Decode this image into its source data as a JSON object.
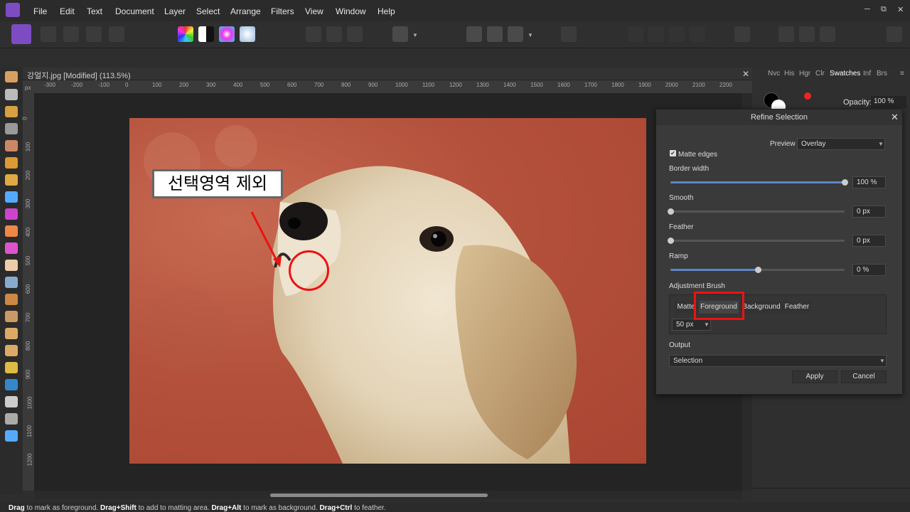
{
  "menu": [
    "File",
    "Edit",
    "Text",
    "Document",
    "Layer",
    "Select",
    "Arrange",
    "Filters",
    "View",
    "Window",
    "Help"
  ],
  "window_controls": [
    "─",
    "⧉",
    "✕"
  ],
  "document": {
    "title": "강얼지.jpg [Modified] (113.5%)",
    "ruler_unit": "px"
  },
  "ruler_h": [
    "-300",
    "-200",
    "-100",
    "0",
    "100",
    "200",
    "300",
    "400",
    "500",
    "600",
    "700",
    "800",
    "900",
    "1000",
    "1100",
    "1200",
    "1300",
    "1400",
    "1500",
    "1600",
    "1700",
    "1800",
    "1900",
    "2000",
    "2100",
    "2200"
  ],
  "ruler_v": [
    "0",
    "100",
    "200",
    "300",
    "400",
    "500",
    "600",
    "700",
    "800",
    "900",
    "1000",
    "1100",
    "1200"
  ],
  "annotation": {
    "label": "선택영역 제외"
  },
  "right_panel": {
    "tabs": [
      "Nvc",
      "His",
      "Hgr",
      "Clr",
      "Swatches",
      "Inf",
      "Brs"
    ],
    "active_tab": "Swatches",
    "opacity_label": "Opacity:",
    "opacity_value": "100 %"
  },
  "refine_dialog": {
    "title": "Refine Selection",
    "preview_label": "Preview",
    "preview_value": "Overlay",
    "matte_edges_label": "Matte edges",
    "matte_edges_checked": true,
    "border_width_label": "Border width",
    "border_width_value": "100 %",
    "border_width_level": 1.0,
    "smooth_label": "Smooth",
    "smooth_value": "0 px",
    "smooth_level": 0.0,
    "feather_label": "Feather",
    "feather_value": "0 px",
    "feather_level": 0.0,
    "ramp_label": "Ramp",
    "ramp_value": "0 %",
    "ramp_level": 0.5,
    "adjustment_brush_label": "Adjustment Brush",
    "brush_modes": [
      "Matte",
      "Foreground",
      "Background",
      "Feather"
    ],
    "brush_mode_selected": "Foreground",
    "brush_size": "50 px",
    "output_label": "Output",
    "output_value": "Selection",
    "apply_label": "Apply",
    "cancel_label": "Cancel"
  },
  "status": {
    "k1": "Drag",
    "t1": " to mark as foreground. ",
    "k2": "Drag+Shift",
    "t2": " to add to matting area. ",
    "k3": "Drag+Alt",
    "t3": " to mark as background. ",
    "k4": "Drag+Ctrl",
    "t4": " to feather."
  },
  "colors": {
    "accent": "#7d4cc2",
    "highlight": "#e11111",
    "slider": "#5a86c6"
  }
}
